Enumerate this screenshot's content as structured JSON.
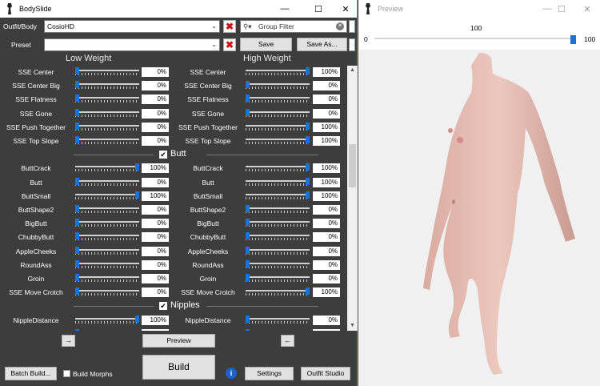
{
  "bodyslide": {
    "title": "BodySlide",
    "outfit_label": "Outfit/Body",
    "outfit_value": "CosioHD",
    "group_filter_placeholder": "Group Filter",
    "preset_label": "Preset",
    "preset_value": "",
    "save_label": "Save",
    "save_as_label": "Save As...",
    "low_weight_label": "Low Weight",
    "high_weight_label": "High Weight",
    "rows": [
      {
        "name": "SSE Center",
        "low": "0%",
        "high": "100%",
        "low_pos": 0,
        "high_pos": 1
      },
      {
        "name": "SSE Center Big",
        "low": "0%",
        "high": "0%",
        "low_pos": 0,
        "high_pos": 0
      },
      {
        "name": "SSE Flatness",
        "low": "0%",
        "high": "0%",
        "low_pos": 0,
        "high_pos": 0
      },
      {
        "name": "SSE Gone",
        "low": "0%",
        "high": "0%",
        "low_pos": 0,
        "high_pos": 0
      },
      {
        "name": "SSE Push Together",
        "low": "0%",
        "high": "100%",
        "low_pos": 0,
        "high_pos": 1
      },
      {
        "name": "SSE Top Slope",
        "low": "0%",
        "high": "100%",
        "low_pos": 0,
        "high_pos": 1
      }
    ],
    "butt_group": "Butt",
    "butt_rows": [
      {
        "name": "ButtCrack",
        "low": "100%",
        "high": "100%",
        "low_pos": 1,
        "high_pos": 1
      },
      {
        "name": "Butt",
        "low": "0%",
        "high": "100%",
        "low_pos": 0,
        "high_pos": 1
      },
      {
        "name": "ButtSmall",
        "low": "100%",
        "high": "100%",
        "low_pos": 1,
        "high_pos": 1
      },
      {
        "name": "ButtShape2",
        "low": "0%",
        "high": "0%",
        "low_pos": 0,
        "high_pos": 0
      },
      {
        "name": "BigButt",
        "low": "0%",
        "high": "0%",
        "low_pos": 0,
        "high_pos": 0
      },
      {
        "name": "ChubbyButt",
        "low": "0%",
        "high": "0%",
        "low_pos": 0,
        "high_pos": 0
      },
      {
        "name": "AppleCheeks",
        "low": "0%",
        "high": "0%",
        "low_pos": 0,
        "high_pos": 0
      },
      {
        "name": "RoundAss",
        "low": "0%",
        "high": "0%",
        "low_pos": 0,
        "high_pos": 0
      },
      {
        "name": "Groin",
        "low": "0%",
        "high": "0%",
        "low_pos": 0,
        "high_pos": 0
      },
      {
        "name": "SSE Move Crotch",
        "low": "0%",
        "high": "100%",
        "low_pos": 0,
        "high_pos": 1
      }
    ],
    "nipples_group": "Nipples",
    "nipple_rows": [
      {
        "name": "NippleDistance",
        "low": "100%",
        "high": "0%",
        "low_pos": 1,
        "high_pos": 0
      },
      {
        "name": "NippleDarkness",
        "low": "0%",
        "high": "0%",
        "low_pos": 0,
        "high_pos": 0
      }
    ],
    "preview_label": "Preview",
    "build_label": "Build",
    "batch_build_label": "Batch Build...",
    "build_morphs_label": "Build Morphs",
    "settings_label": "Settings",
    "outfit_studio_label": "Outfit Studio",
    "arrow_right": "→",
    "arrow_left": "←"
  },
  "preview": {
    "title": "Preview",
    "slider_min": "0",
    "slider_max": "100",
    "slider_value": "100",
    "slider_value_fraction": 1.0
  },
  "colors": {
    "panel_bg": "#3d3d3d",
    "accent": "#1a73d9",
    "close_x": "#d01010",
    "viewport_bg": "#f0f0f0"
  }
}
